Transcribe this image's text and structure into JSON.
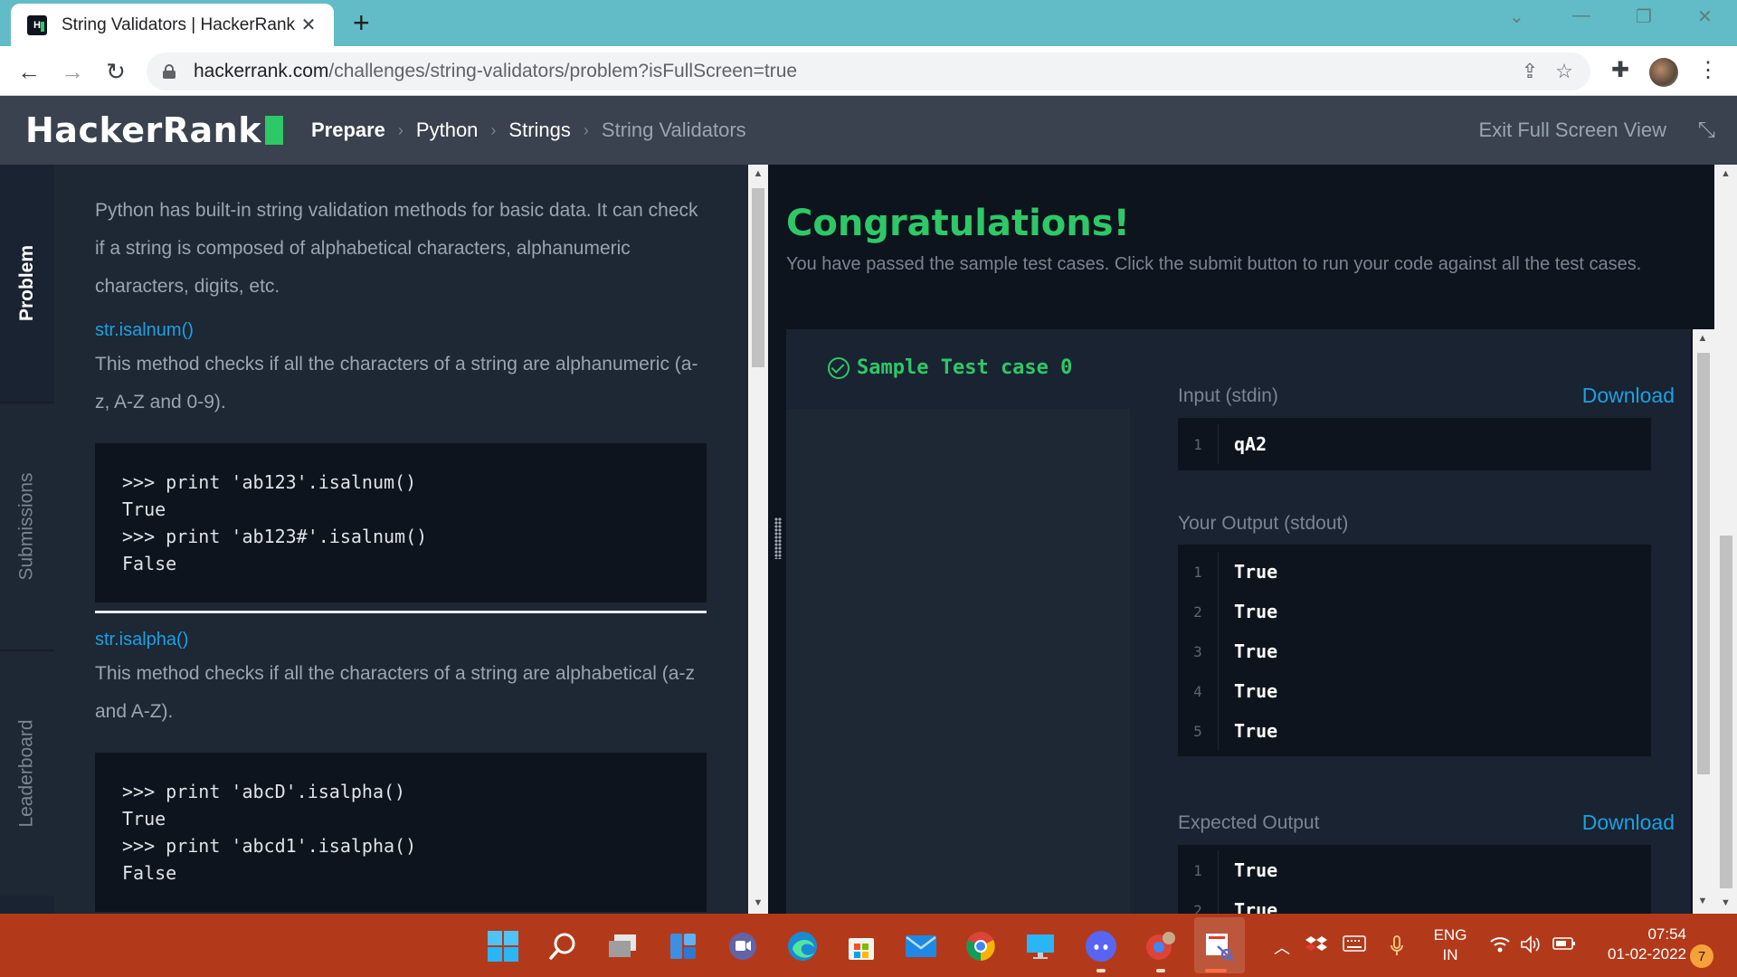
{
  "browser": {
    "tab_title": "String Validators | HackerRank",
    "tab_favicon_text": "H",
    "url_host": "hackerrank.com",
    "url_path": "/challenges/string-validators/problem?isFullScreen=true"
  },
  "header": {
    "logo": "HackerRank",
    "breadcrumbs": [
      "Prepare",
      "Python",
      "Strings",
      "String Validators"
    ],
    "exit_fullscreen": "Exit Full Screen View"
  },
  "vnav": {
    "items": [
      "Problem",
      "Submissions",
      "Leaderboard"
    ],
    "active": "Problem"
  },
  "problem": {
    "intro": "Python has built-in string validation methods for basic data. It can check if a string is composed of alphabetical characters, alphanumeric characters, digits, etc.",
    "sections": [
      {
        "method": "str.isalnum()",
        "desc": "This method checks if all the characters of a string are alphanumeric (a-z, A-Z and 0-9).",
        "code": [
          ">>> print 'ab123'.isalnum()",
          "True",
          ">>> print 'ab123#'.isalnum()",
          "False"
        ]
      },
      {
        "method": "str.isalpha()",
        "desc": "This method checks if all the characters of a string are alphabetical (a-z and A-Z).",
        "code": [
          ">>> print 'abcD'.isalpha()",
          "True",
          ">>> print 'abcd1'.isalpha()",
          "False"
        ]
      }
    ]
  },
  "results": {
    "title": "Congratulations!",
    "message": "You have passed the sample test cases. Click the submit button to run your code against all the test cases.",
    "test_case_label": "Sample Test case 0",
    "input_label": "Input (stdin)",
    "output_label": "Your Output (stdout)",
    "expected_label": "Expected Output",
    "download_label": "Download",
    "input_lines": [
      {
        "n": "1",
        "v": "qA2"
      }
    ],
    "output_lines": [
      {
        "n": "1",
        "v": "True"
      },
      {
        "n": "2",
        "v": "True"
      },
      {
        "n": "3",
        "v": "True"
      },
      {
        "n": "4",
        "v": "True"
      },
      {
        "n": "5",
        "v": "True"
      }
    ],
    "expected_lines": [
      {
        "n": "1",
        "v": "True"
      },
      {
        "n": "2",
        "v": "True"
      }
    ]
  },
  "taskbar": {
    "lang_line1": "ENG",
    "lang_line2": "IN",
    "time": "07:54",
    "date": "01-02-2022",
    "notifications": "7"
  },
  "colors": {
    "accent_green": "#2ec866",
    "link_blue": "#1ba1e2",
    "header_bg": "#39424e",
    "taskbar_bg": "#b23a1a"
  }
}
